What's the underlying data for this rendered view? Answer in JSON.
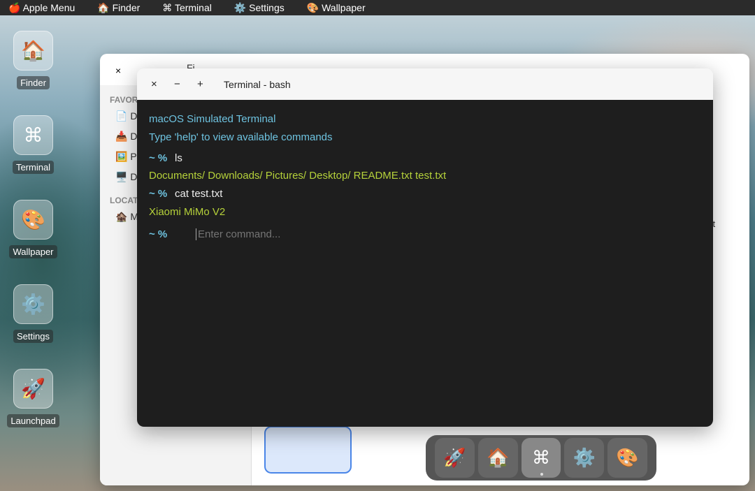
{
  "menubar": {
    "items": [
      {
        "icon": "🍎",
        "label": "Apple Menu"
      },
      {
        "icon": "🏠",
        "label": "Finder"
      },
      {
        "icon": "⌘",
        "label": "Terminal"
      },
      {
        "icon": "⚙️",
        "label": "Settings"
      },
      {
        "icon": "🎨",
        "label": "Wallpaper"
      }
    ]
  },
  "desktop": {
    "icons": [
      {
        "icon": "🏠",
        "label": "Finder"
      },
      {
        "icon": "⌘",
        "label": "Terminal"
      },
      {
        "icon": "🎨",
        "label": "Wallpaper"
      },
      {
        "icon": "⚙️",
        "label": "Settings"
      },
      {
        "icon": "🚀",
        "label": "Launchpad"
      }
    ]
  },
  "finder": {
    "close": "×",
    "title": "Fi",
    "favorites_header": "FAVOR",
    "favorites": [
      {
        "icon": "📄",
        "label": "Do"
      },
      {
        "icon": "📥",
        "label": "Do"
      },
      {
        "icon": "🖼️",
        "label": "Pi"
      },
      {
        "icon": "🖥️",
        "label": "De"
      }
    ],
    "locations_header": "LOCAT",
    "locations": [
      {
        "icon": "🏚️",
        "label": "M"
      }
    ],
    "file_label_partial": "xt"
  },
  "terminal": {
    "close": "×",
    "minimize": "−",
    "maximize": "+",
    "title": "Terminal - bash",
    "lines": {
      "banner1": "macOS Simulated Terminal",
      "banner2": "Type 'help' to view available commands",
      "prompt": "~ %",
      "cmd1": "ls",
      "out1": "Documents/  Downloads/  Pictures/  Desktop/  README.txt  test.txt",
      "cmd2": "cat test.txt",
      "out2": "Xiaomi MiMo V2"
    },
    "input_placeholder": "Enter command..."
  },
  "dock": {
    "items": [
      {
        "icon": "🚀",
        "name": "Launchpad"
      },
      {
        "icon": "🏠",
        "name": "Finder"
      },
      {
        "icon": "⌘",
        "name": "Terminal",
        "active": true
      },
      {
        "icon": "⚙️",
        "name": "Settings"
      },
      {
        "icon": "🎨",
        "name": "Wallpaper"
      }
    ]
  }
}
